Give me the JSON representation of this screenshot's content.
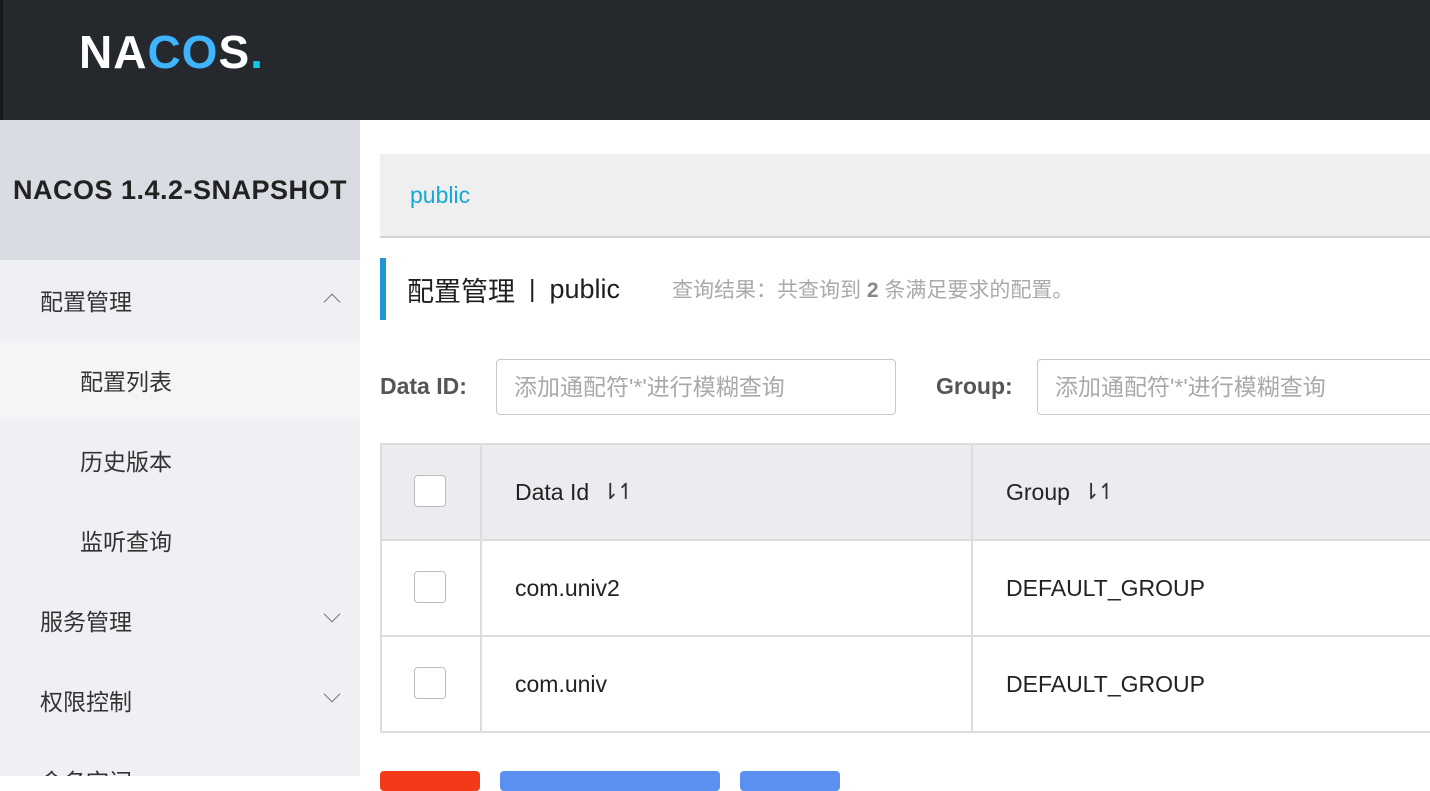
{
  "header": {
    "logo_text_a": "NA",
    "logo_text_oo": "CO",
    "logo_text_b": "S",
    "logo_dot": "."
  },
  "sidebar": {
    "version": "NACOS 1.4.2-SNAPSHOT",
    "items": [
      {
        "label": "配置管理",
        "level": 1,
        "expanded": true
      },
      {
        "label": "配置列表",
        "level": 2,
        "active": true
      },
      {
        "label": "历史版本",
        "level": 2
      },
      {
        "label": "监听查询",
        "level": 2
      },
      {
        "label": "服务管理",
        "level": 1,
        "expanded": false
      },
      {
        "label": "权限控制",
        "level": 1,
        "expanded": false
      },
      {
        "label": "命名空间",
        "level": 1
      }
    ]
  },
  "namespace_bar": {
    "current": "public"
  },
  "page": {
    "title": "配置管理",
    "separator": "|",
    "namespace": "public",
    "result_prefix": "查询结果：共查询到",
    "result_count": "2",
    "result_suffix": "条满足要求的配置。"
  },
  "search": {
    "data_id_label": "Data ID:",
    "data_id_placeholder": "添加通配符'*'进行模糊查询",
    "group_label": "Group:",
    "group_placeholder": "添加通配符'*'进行模糊查询"
  },
  "table": {
    "columns": [
      {
        "label": "Data Id",
        "sort_icon": "⇂↿"
      },
      {
        "label": "Group",
        "sort_icon": "⇂↿"
      }
    ],
    "rows": [
      {
        "data_id": "com.univ2",
        "group": "DEFAULT_GROUP"
      },
      {
        "data_id": "com.univ",
        "group": "DEFAULT_GROUP"
      }
    ]
  },
  "colors": {
    "accent": "#2196d6",
    "link": "#13a8d8",
    "topbar": "#25282d",
    "danger": "#f23a1a",
    "primary": "#5b8ff0"
  }
}
